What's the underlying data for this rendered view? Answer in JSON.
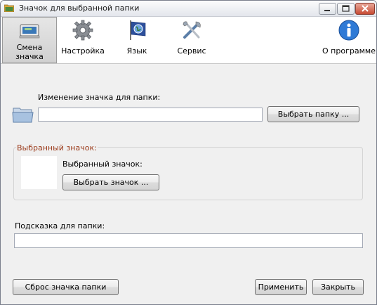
{
  "window": {
    "title": "Значок для выбранной папки"
  },
  "toolbar": {
    "items": [
      {
        "label": "Смена\nзначка",
        "icon": "change-icon",
        "active": true
      },
      {
        "label": "Настройка",
        "icon": "gear-icon",
        "active": false
      },
      {
        "label": "Язык",
        "icon": "flag-globe-icon",
        "active": false
      },
      {
        "label": "Сервис",
        "icon": "tools-icon",
        "active": false
      },
      {
        "label": "О программе",
        "icon": "info-icon",
        "active": false
      }
    ]
  },
  "main": {
    "folder_label": "Изменение значка для папки:",
    "folder_value": "",
    "choose_folder_button": "Выбрать папку ...",
    "selected_group_title": "Выбранный значок:",
    "selected_icon_label": "Выбранный значок:",
    "choose_icon_button": "Выбрать значок ...",
    "tooltip_label": "Подсказка для папки:",
    "tooltip_value": ""
  },
  "footer": {
    "reset_button": "Сброс значка папки",
    "apply_button": "Применить",
    "close_button": "Закрыть"
  },
  "colors": {
    "group_title": "#9b3b1b",
    "close_button_red": "#c74a33"
  }
}
